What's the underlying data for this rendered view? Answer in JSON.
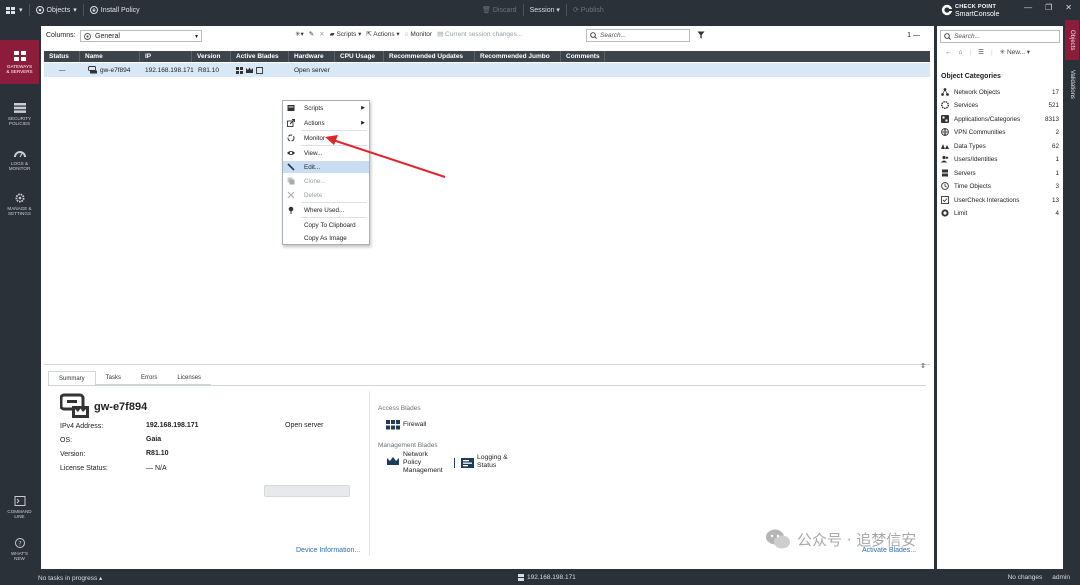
{
  "topbar": {
    "menu_label": "",
    "objects_label": "Objects",
    "install_policy_label": "Install Policy",
    "discard_label": "Discard",
    "session_label": "Session",
    "publish_label": "Publish",
    "brand_top": "CHECK POINT",
    "brand_bottom": "SmartConsole"
  },
  "leftnav": [
    {
      "label1": "GATEWAYS",
      "label2": "& SERVERS",
      "active": true
    },
    {
      "label1": "SECURITY",
      "label2": "POLICIES",
      "active": false
    },
    {
      "label1": "LOGS &",
      "label2": "MONITOR",
      "active": false
    },
    {
      "label1": "MANAGE &",
      "label2": "SETTINGS",
      "active": false
    }
  ],
  "leftnav_bottom": [
    {
      "label1": "COMMAND",
      "label2": "LINE"
    },
    {
      "label1": "WHAT'S",
      "label2": "NEW"
    }
  ],
  "toolbar": {
    "columns_label": "Columns:",
    "columns_value": "General",
    "scripts_label": "Scripts",
    "actions_label": "Actions",
    "monitor_label": "Monitor",
    "session_changes_label": "Current session changes...",
    "search_placeholder": "Search...",
    "page_count": "1 —"
  },
  "grid": {
    "columns": [
      "Status",
      "Name",
      "IP",
      "Version",
      "Active Blades",
      "Hardware",
      "CPU Usage",
      "Recommended Updates",
      "Recommended Jumbo",
      "Comments"
    ],
    "rows": [
      {
        "status": "—",
        "name": "gw-e7f894",
        "ip": "192.168.198.171",
        "version": "R81.10",
        "hardware": "Open server"
      }
    ]
  },
  "context_menu": {
    "items": [
      {
        "label": "Scripts",
        "submenu": true,
        "disabled": false,
        "icon": "scripts-icon"
      },
      {
        "label": "Actions",
        "submenu": true,
        "disabled": false,
        "icon": "actions-icon"
      },
      {
        "label": "Monitor",
        "submenu": false,
        "disabled": false,
        "icon": "monitor-icon"
      },
      {
        "label": "View...",
        "submenu": false,
        "disabled": false,
        "icon": "eye-icon"
      },
      {
        "label": "Edit...",
        "submenu": false,
        "disabled": false,
        "icon": "pencil-icon",
        "highlighted": true
      },
      {
        "label": "Clone...",
        "submenu": false,
        "disabled": true,
        "icon": "clone-icon"
      },
      {
        "label": "Delete",
        "submenu": false,
        "disabled": true,
        "icon": "delete-icon"
      },
      {
        "label": "Where Used...",
        "submenu": false,
        "disabled": false,
        "icon": "pin-icon"
      },
      {
        "label": "Copy To Clipboard",
        "submenu": false,
        "disabled": false,
        "icon": ""
      },
      {
        "label": "Copy As Image",
        "submenu": false,
        "disabled": false,
        "icon": ""
      }
    ]
  },
  "details": {
    "tabs": [
      "Summary",
      "Tasks",
      "Errors",
      "Licenses"
    ],
    "title": "gw-e7f894",
    "fields": [
      {
        "key": "IPv4 Address:",
        "value": "192.168.198.171"
      },
      {
        "key": "OS:",
        "value": "Gaia"
      },
      {
        "key": "Version:",
        "value": "R81.10"
      },
      {
        "key": "License Status:",
        "value": "— N/A"
      }
    ],
    "hardware": "Open server",
    "device_info_link": "Device Information...",
    "access_blades_title": "Access Blades",
    "firewall_label": "Firewall",
    "management_blades_title": "Management Blades",
    "network_policy_l1": "Network",
    "network_policy_l2": "Policy",
    "network_policy_l3": "Management",
    "logging_l1": "Logging &",
    "logging_l2": "Status",
    "activate_link": "Activate Blades..."
  },
  "right_panel": {
    "search_placeholder": "Search...",
    "new_label": "New...",
    "heading": "Object Categories",
    "categories": [
      {
        "label": "Network Objects",
        "count": "17",
        "icon": "network-objects-icon"
      },
      {
        "label": "Services",
        "count": "521",
        "icon": "services-icon"
      },
      {
        "label": "Applications/Categories",
        "count": "8313",
        "icon": "applications-icon"
      },
      {
        "label": "VPN Communities",
        "count": "2",
        "icon": "vpn-icon"
      },
      {
        "label": "Data Types",
        "count": "62",
        "icon": "data-types-icon"
      },
      {
        "label": "Users/Identities",
        "count": "1",
        "icon": "users-icon"
      },
      {
        "label": "Servers",
        "count": "1",
        "icon": "servers-icon"
      },
      {
        "label": "Time Objects",
        "count": "3",
        "icon": "time-icon"
      },
      {
        "label": "UserCheck Interactions",
        "count": "13",
        "icon": "usercheck-icon"
      },
      {
        "label": "Limit",
        "count": "4",
        "icon": "limit-icon"
      }
    ],
    "side_tabs": [
      "Objects",
      "Validations"
    ]
  },
  "statusbar": {
    "left": "No tasks in progress",
    "mid": "192.168.198.171",
    "changes": "No changes",
    "user": "admin"
  },
  "watermark": "公众号 · 追梦信安",
  "colors": {
    "accent": "#8c1d3a",
    "dark": "#2b3138",
    "selection": "#d8e8f6",
    "arrow": "#e0262d"
  }
}
